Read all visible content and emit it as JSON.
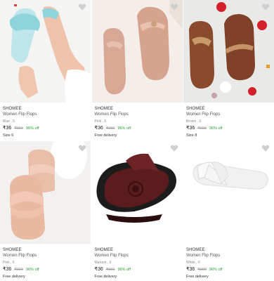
{
  "products": [
    {
      "brand": "SHOMEE",
      "title": "Women Flip Flops",
      "variant": "Blue , 5",
      "price": "₹36",
      "mrp": "₹999",
      "discount": "96% off",
      "extra": "Size 6",
      "photo": "light-blue-twisted-slipper-on-foot"
    },
    {
      "brand": "SHOMEE",
      "title": "Women Flip Flops",
      "variant": "Pink , 5",
      "price": "₹36",
      "mrp": "₹999",
      "discount": "96% off",
      "extra": "Free delivery",
      "photo": "pink-thong-sandal-pair"
    },
    {
      "brand": "SHOMEE",
      "title": "Women Flip Flops",
      "variant": "Brown , 6",
      "price": "₹36",
      "mrp": "₹999",
      "discount": "96% off",
      "extra": "Size 8",
      "photo": "brown-thong-sandal-pair-with-roses"
    },
    {
      "brand": "SHOMEE",
      "title": "Women Flip Flops",
      "variant": "Pink , 6",
      "price": "₹36",
      "mrp": "₹999",
      "discount": "96% off",
      "extra": "Free delivery",
      "photo": "pink-cross-strap-slides"
    },
    {
      "brand": "SHOMEE",
      "title": "Women Flip Flops",
      "variant": "Maroon , 6",
      "price": "₹36",
      "mrp": "₹999",
      "discount": "96% off",
      "extra": "Free delivery",
      "photo": "maroon-kolhapuri-sandal"
    },
    {
      "brand": "SHOMEE",
      "title": "Women Flip Flops",
      "variant": "White , 6",
      "price": "₹36",
      "mrp": "₹999",
      "discount": "96% off",
      "extra": "Free delivery",
      "photo": "white-cross-strap-slide"
    }
  ],
  "colors": {
    "discount": "#2e9e3a",
    "heart": "#cfcfcf"
  },
  "icons": {
    "wishlist": "heart-icon"
  }
}
